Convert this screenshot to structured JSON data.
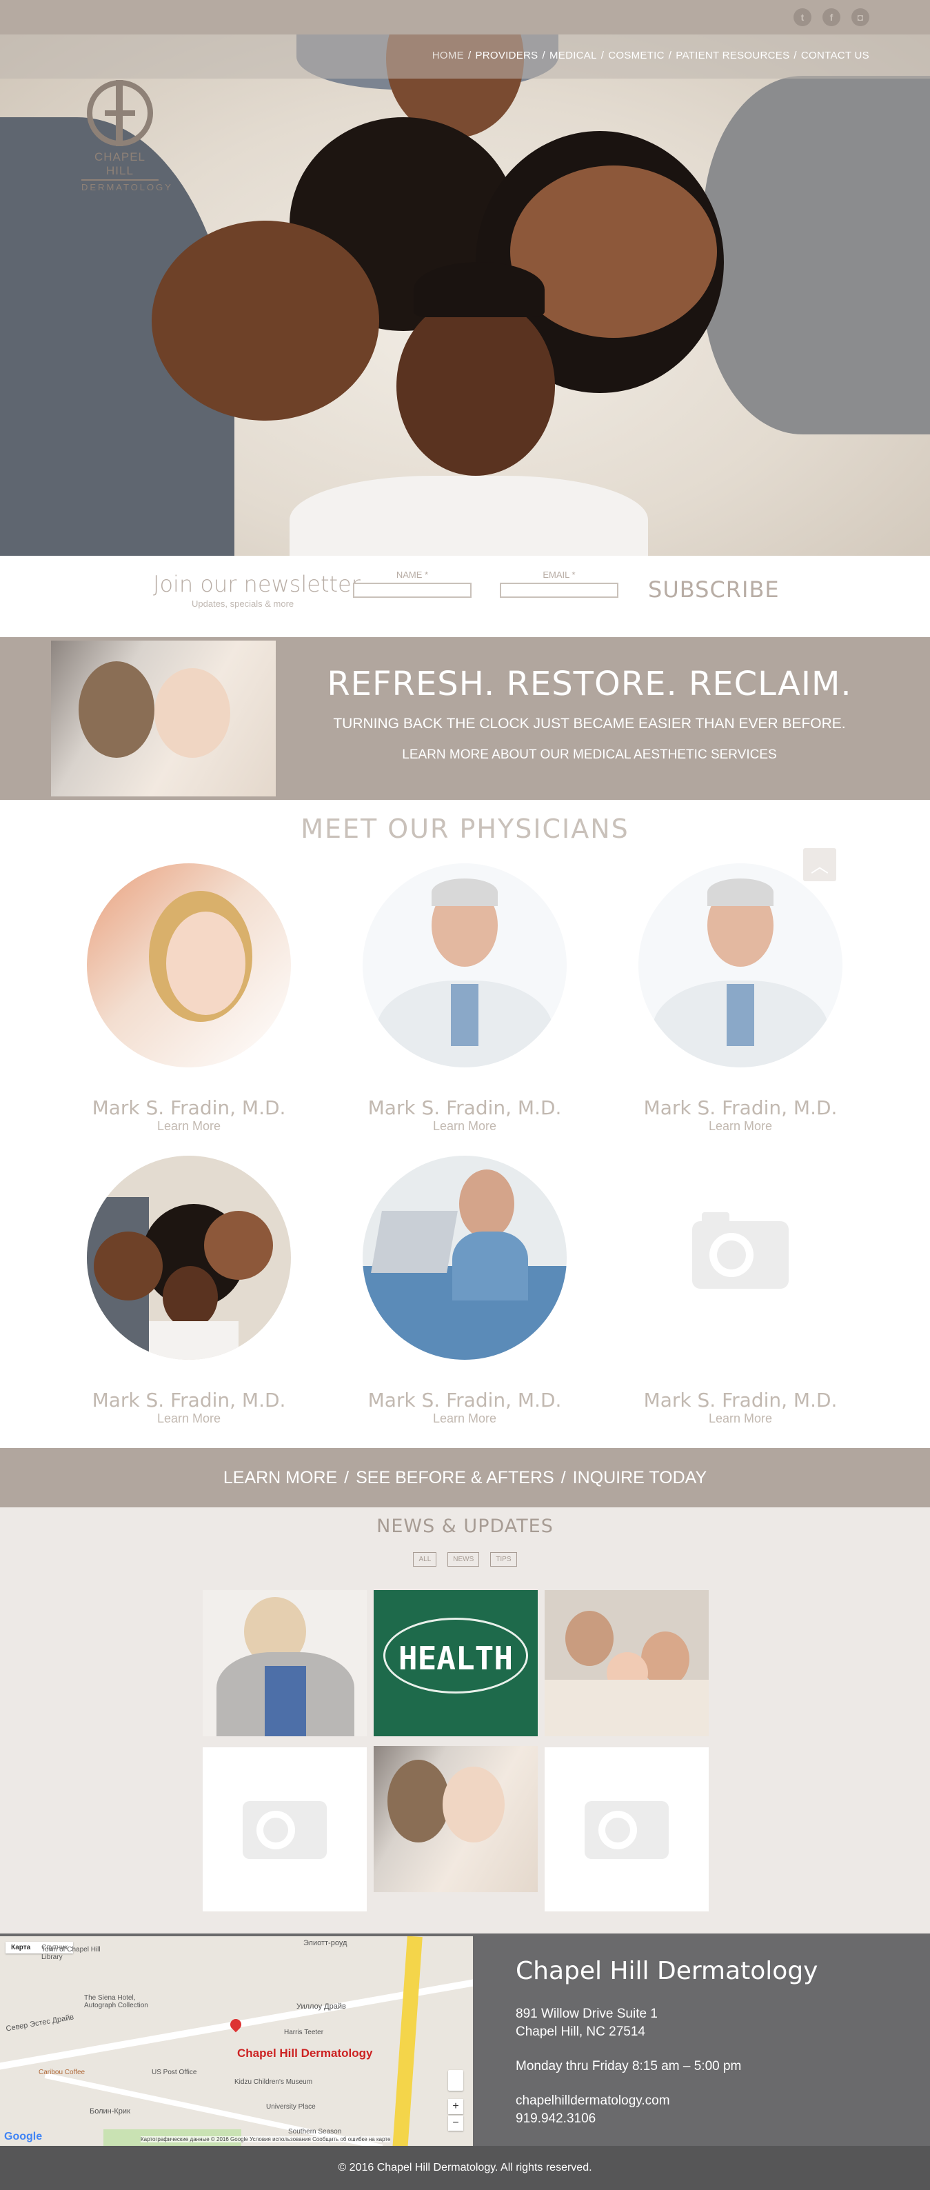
{
  "header": {
    "social": [
      {
        "icon": "twitter-icon",
        "glyph": "t"
      },
      {
        "icon": "facebook-icon",
        "glyph": "f"
      },
      {
        "icon": "instagram-icon",
        "glyph": "◘"
      }
    ],
    "nav": [
      {
        "label": "HOME"
      },
      {
        "label": "PROVIDERS"
      },
      {
        "label": "MEDICAL"
      },
      {
        "label": "COSMETIC"
      },
      {
        "label": "PATIENT RESOURCES"
      },
      {
        "label": "CONTACT US"
      }
    ],
    "separator": "/",
    "logo": {
      "name": "Chapel Hill",
      "sub": "Dermatology"
    }
  },
  "newsletter": {
    "title": "Join our newsletter",
    "subtitle": "Updates, specials & more",
    "name_label": "NAME *",
    "email_label": "EMAIL *",
    "name_value": "",
    "email_value": "",
    "button": "SUBSCRIBE"
  },
  "aesthetic": {
    "heading": "REFRESH. RESTORE. RECLAIM.",
    "line1": "TURNING BACK THE CLOCK JUST BECAME EASIER THAN EVER BEFORE.",
    "line2": "LEARN MORE ABOUT OUR MEDICAL AESTHETIC SERVICES"
  },
  "physicians": {
    "title": "MEET OUR PHYSICIANS",
    "up_glyph": "︿",
    "items": [
      {
        "name": "Mark S. Fradin, M.D.",
        "link": "Learn More",
        "photo": "woman-portrait"
      },
      {
        "name": "Mark S. Fradin, M.D.",
        "link": "Learn More",
        "photo": "doctor-portrait"
      },
      {
        "name": "Mark S. Fradin, M.D.",
        "link": "Learn More",
        "photo": "doctor-portrait"
      },
      {
        "name": "Mark S. Fradin, M.D.",
        "link": "Learn More",
        "photo": "family-portrait"
      },
      {
        "name": "Mark S. Fradin, M.D.",
        "link": "Learn More",
        "photo": "doctor-laptop"
      },
      {
        "name": "Mark S. Fradin, M.D.",
        "link": "Learn More",
        "photo": "placeholder"
      }
    ]
  },
  "cta": {
    "items": [
      {
        "label": "LEARN MORE"
      },
      {
        "label": "SEE BEFORE & AFTERS"
      },
      {
        "label": "INQUIRE TODAY"
      }
    ],
    "separator": "/"
  },
  "news": {
    "title": "NEWS & UPDATES",
    "filters": [
      "ALL",
      "NEWS",
      "TIPS"
    ],
    "tiles": [
      {
        "kind": "woman-hands"
      },
      {
        "kind": "health-board",
        "text": "HEALTH"
      },
      {
        "kind": "family"
      },
      {
        "kind": "placeholder"
      },
      {
        "kind": "woman-smile"
      },
      {
        "kind": "placeholder"
      }
    ]
  },
  "map": {
    "type_map": "Карта",
    "type_sat": "Спутник",
    "marker_label": "Chapel Hill Dermatology",
    "labels": {
      "l1": "Town of Chapel Hill Library",
      "l2": "The Siena Hotel, Autograph Collection",
      "l3": "Harris Teeter",
      "l4": "Caribou Coffee",
      "l5": "US Post Office",
      "l6": "Kidzu Children's Museum",
      "l7": "University Place",
      "l8": "Southern Season",
      "l9": "Элиотт-роуд",
      "l10": "Уиллоу Драйв",
      "l11": "Север Эстес Драйв",
      "l12": "Болин-Крик"
    },
    "attribution": "Картографические данные © 2016 Google   Условия использования   Сообщить об ошибке на карте",
    "google": "Google"
  },
  "contact": {
    "name": "Chapel Hill Dermatology",
    "address1": "891 Willow Drive Suite 1",
    "address2": "Chapel Hill, NC 27514",
    "hours": "Monday thru Friday 8:15 am – 5:00 pm",
    "website": "chapelhilldermatology.com",
    "phone": "919.942.3106"
  },
  "footer": {
    "copyright": "© 2016 Chapel Hill Dermatology. All rights reserved."
  }
}
